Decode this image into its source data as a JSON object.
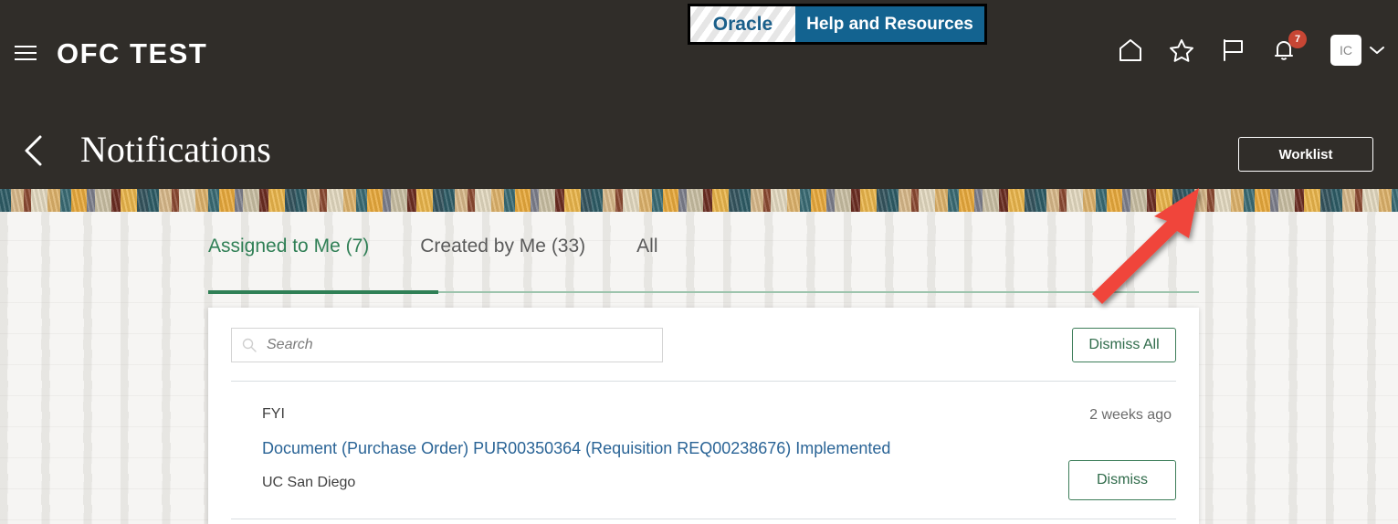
{
  "header": {
    "menu_icon": "hamburger-icon",
    "brand": "OFC TEST",
    "oracle_badge": {
      "left_text": "Oracle",
      "right_text": "Help and Resources"
    },
    "icons": [
      {
        "name": "home-icon",
        "label": "Home"
      },
      {
        "name": "star-icon",
        "label": "Favorites"
      },
      {
        "name": "flag-icon",
        "label": "Flag"
      },
      {
        "name": "bell-icon",
        "label": "Notifications"
      }
    ],
    "notification_count": "7",
    "avatar_initials": "IC",
    "avatar_chevron": "chevron-down-icon"
  },
  "subheader": {
    "back_icon": "back-chevron-icon",
    "title": "Notifications",
    "worklist_label": "Worklist"
  },
  "tabs": [
    {
      "label": "Assigned to Me (7)",
      "active": true
    },
    {
      "label": "Created by Me (33)",
      "active": false
    },
    {
      "label": "All",
      "active": false
    }
  ],
  "toolbar": {
    "search_placeholder": "Search",
    "search_value": "",
    "search_icon": "search-icon",
    "dismiss_all_label": "Dismiss All"
  },
  "notifications": [
    {
      "type": "FYI",
      "title": "Document (Purchase Order) PUR00350364 (Requisition REQ00238676) Implemented",
      "org": "UC San Diego",
      "time": "2 weeks ago",
      "dismiss_label": "Dismiss"
    }
  ],
  "annotation": {
    "shape": "arrow",
    "color": "#f0443a",
    "points_to": "Worklist button"
  },
  "colors": {
    "header_bg": "#302d29",
    "accent_green": "#2f7f55",
    "link_blue": "#2a6496",
    "badge_red": "#c74634",
    "oracle_blue": "#136390"
  }
}
